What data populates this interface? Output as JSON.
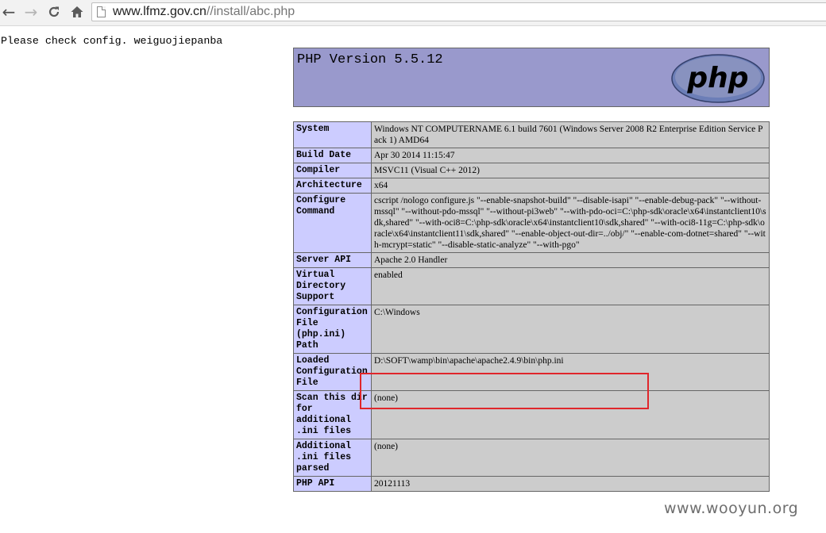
{
  "browser": {
    "url_host": "www.lfmz.gov.cn",
    "url_path": "//install/abc.php"
  },
  "page": {
    "message": "Please check config. weiguojiepanba"
  },
  "phpinfo": {
    "title": "PHP Version 5.5.12",
    "logo_text": "php",
    "rows": [
      {
        "key": "System",
        "value": "Windows NT COMPUTERNAME 6.1 build 7601 (Windows Server 2008 R2 Enterprise Edition Service Pack 1) AMD64"
      },
      {
        "key": "Build Date",
        "value": "Apr 30 2014 11:15:47"
      },
      {
        "key": "Compiler",
        "value": "MSVC11 (Visual C++ 2012)"
      },
      {
        "key": "Architecture",
        "value": "x64"
      },
      {
        "key": "Configure Command",
        "value": "cscript /nologo configure.js \"--enable-snapshot-build\" \"--disable-isapi\" \"--enable-debug-pack\" \"--without-mssql\" \"--without-pdo-mssql\" \"--without-pi3web\" \"--with-pdo-oci=C:\\php-sdk\\oracle\\x64\\instantclient10\\sdk,shared\" \"--with-oci8=C:\\php-sdk\\oracle\\x64\\instantclient10\\sdk,shared\" \"--with-oci8-11g=C:\\php-sdk\\oracle\\x64\\instantclient11\\sdk,shared\" \"--enable-object-out-dir=../obj/\" \"--enable-com-dotnet=shared\" \"--with-mcrypt=static\" \"--disable-static-analyze\" \"--with-pgo\""
      },
      {
        "key": "Server API",
        "value": "Apache 2.0 Handler"
      },
      {
        "key": "Virtual Directory Support",
        "value": "enabled"
      },
      {
        "key": "Configuration File (php.ini) Path",
        "value": "C:\\Windows"
      },
      {
        "key": "Loaded Configuration File",
        "value": "D:\\SOFT\\wamp\\bin\\apache\\apache2.4.9\\bin\\php.ini"
      },
      {
        "key": "Scan this dir for additional .ini files",
        "value": "(none)"
      },
      {
        "key": "Additional .ini files parsed",
        "value": "(none)"
      },
      {
        "key": "PHP API",
        "value": "20121113"
      }
    ]
  },
  "watermark": "www.wooyun.org",
  "colors": {
    "header_bg": "#9999cc",
    "key_bg": "#ccccff",
    "value_bg": "#cccccc",
    "highlight": "#e0262b"
  }
}
